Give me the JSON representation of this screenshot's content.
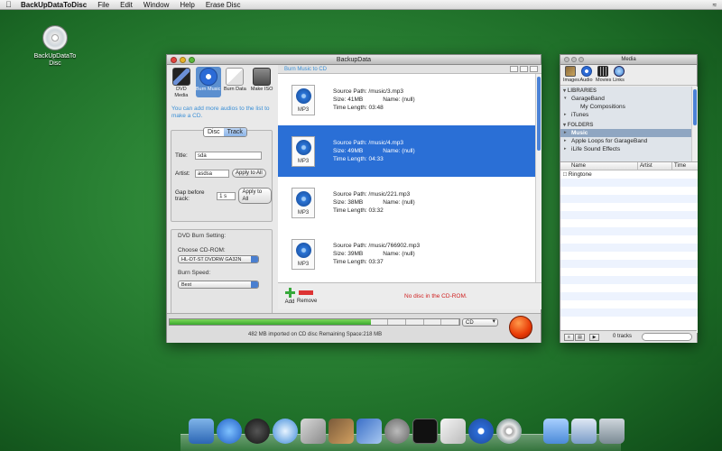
{
  "menubar": {
    "app_name": "BackUpDataToDisc",
    "items": [
      "File",
      "Edit",
      "Window",
      "Help",
      "Erase Disc"
    ]
  },
  "desktop_icon": {
    "label": "BackUpDataTo\nDisc"
  },
  "main_window": {
    "title": "BackupData",
    "toolbar": [
      {
        "label": "DVD Media",
        "icon": "dvd-media-icon",
        "selected": false
      },
      {
        "label": "Burn Music",
        "icon": "music-disc-icon",
        "selected": true
      },
      {
        "label": "Burn Data",
        "icon": "burn-data-icon",
        "selected": false
      },
      {
        "label": "Make ISO",
        "icon": "make-iso-icon",
        "selected": false
      }
    ],
    "hint": "You can add more audios to the list to make a CD.",
    "segments": {
      "disc": "Disc",
      "track": "Track",
      "selected": "Track"
    },
    "fields": {
      "title_label": "Title:",
      "title_value": "sda",
      "artist_label": "Artist:",
      "artist_value": "asdsa",
      "apply_all": "Apply to All",
      "gap_label": "Gap before track:",
      "gap_value": "1 s"
    },
    "burn_setting": {
      "heading": "DVD Burn Setting:",
      "cdrom_label": "Choose CD-ROM:",
      "cdrom_value": "HL-DT-ST DVDRW GA32N",
      "speed_label": "Burn Speed:",
      "speed_value": "Best"
    },
    "list_header": "Burn Music to CD",
    "tracks": [
      {
        "icon_tag": "MP3",
        "path": "Source Path: /music/3.mp3",
        "size": "Size: 41MB",
        "name": "Name: (null)",
        "length": "Time Length: 03:48",
        "selected": false
      },
      {
        "icon_tag": "MP3",
        "path": "Source Path: /music/4.mp3",
        "size": "Size: 49MB",
        "name": "Name: (null)",
        "length": "Time Length: 04:33",
        "selected": true
      },
      {
        "icon_tag": "MP3",
        "path": "Source Path: /music/221.mp3",
        "size": "Size: 38MB",
        "name": "Name: (null)",
        "length": "Time Length: 03:32",
        "selected": false
      },
      {
        "icon_tag": "MP3",
        "path": "Source Path: /music/766902.mp3",
        "size": "Size: 39MB",
        "name": "Name: (null)",
        "length": "Time Length: 03:37",
        "selected": false
      }
    ],
    "add_label": "Add",
    "remove_label": "Remove",
    "no_disc": "No disc in the CD-ROM.",
    "media_type": "CD",
    "status": "482 MB imported  on CD disc  Remaining Space:218 MB",
    "progress_fraction": 0.69,
    "colors": {
      "accent": "#2a6fd6",
      "hint": "#3a8fd6",
      "error": "#d02020",
      "progress": "#39a82e",
      "burn": "#e83a06"
    }
  },
  "media_window": {
    "title": "Media",
    "tools": [
      {
        "label": "Images",
        "icon": "images-icon"
      },
      {
        "label": "Audio",
        "icon": "audio-icon"
      },
      {
        "label": "Movies",
        "icon": "movies-icon"
      },
      {
        "label": "Links",
        "icon": "links-icon"
      }
    ],
    "libraries_heading": "LIBRARIES",
    "libraries": [
      {
        "label": "GarageBand",
        "level": 1
      },
      {
        "label": "My Compositions",
        "level": 2
      },
      {
        "label": "iTunes",
        "level": 1
      }
    ],
    "folders_heading": "FOLDERS",
    "folders": [
      {
        "label": "Music",
        "selected": true
      },
      {
        "label": "Apple Loops for GarageBand",
        "selected": false
      },
      {
        "label": "iLife Sound Effects",
        "selected": false
      }
    ],
    "columns": [
      "Name",
      "Artist",
      "Time"
    ],
    "rows": [
      "Ringtone"
    ],
    "track_count": "0 tracks"
  }
}
